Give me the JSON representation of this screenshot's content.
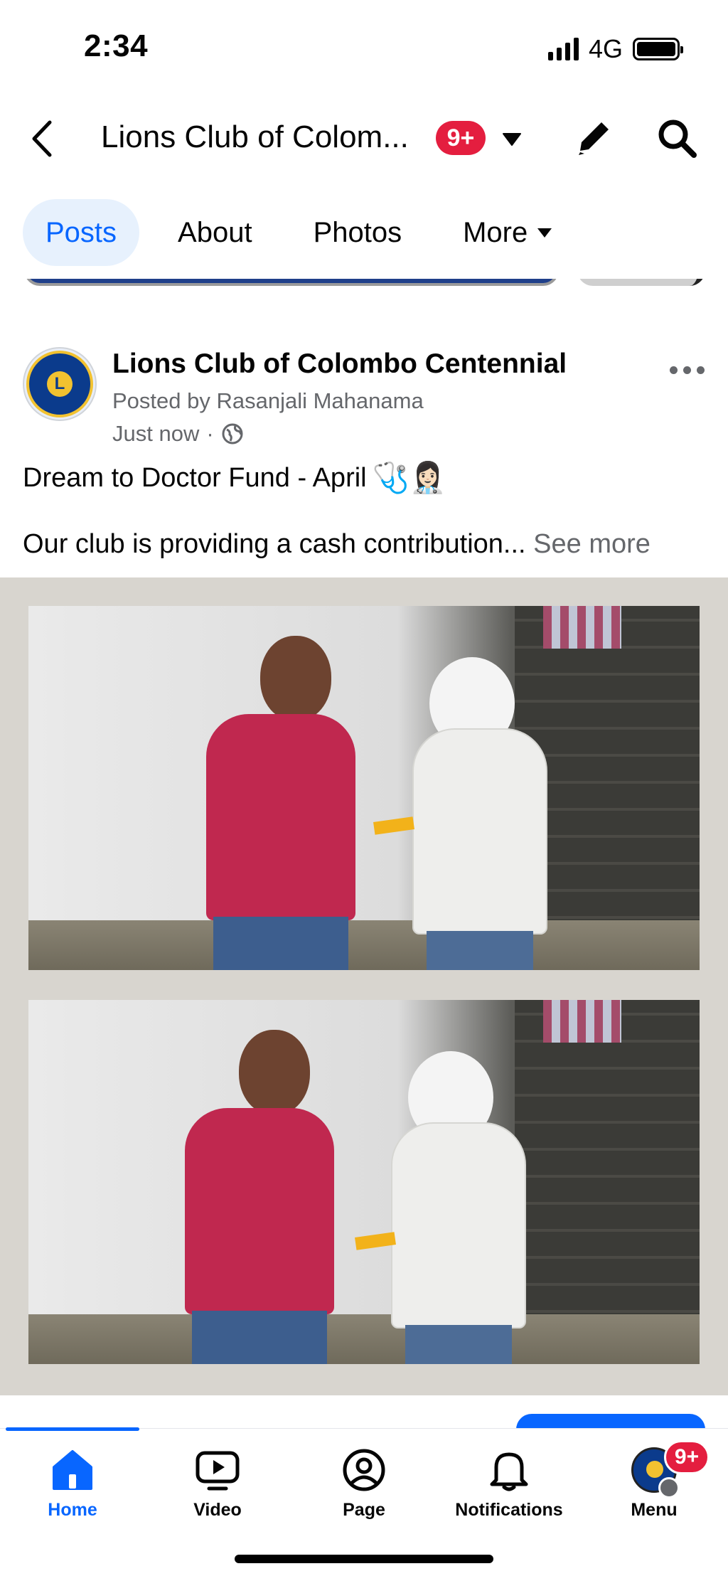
{
  "status_bar": {
    "time": "2:34",
    "network": "4G"
  },
  "header": {
    "title": "Lions Club of Colom...",
    "badge": "9+"
  },
  "tabs": [
    {
      "label": "Posts",
      "active": true
    },
    {
      "label": "About"
    },
    {
      "label": "Photos"
    },
    {
      "label": "More"
    }
  ],
  "post": {
    "author": "Lions Club of Colombo Centennial",
    "posted_by": "Posted by Rasanjali Mahanama",
    "time": "Just now",
    "separator": "·",
    "line1": "Dream to Doctor Fund - April",
    "line1_emoji": "🩺👩🏻‍⚕️",
    "line2": "Our club is providing a cash contribution...",
    "see_more": "See more"
  },
  "bottom_nav": {
    "items": [
      {
        "label": "Home",
        "icon": "home-icon",
        "active": true
      },
      {
        "label": "Video",
        "icon": "video-icon"
      },
      {
        "label": "Page",
        "icon": "page-icon"
      },
      {
        "label": "Notifications",
        "icon": "bell-icon"
      },
      {
        "label": "Menu",
        "icon": "menu-avatar"
      }
    ],
    "menu_badge": "9+"
  },
  "colors": {
    "accent": "#0866ff",
    "badge": "#e41e3f",
    "active_tab_bg": "#e7f1fd",
    "secondary_text": "#65676b",
    "photo_background": "#d8d5cf"
  }
}
